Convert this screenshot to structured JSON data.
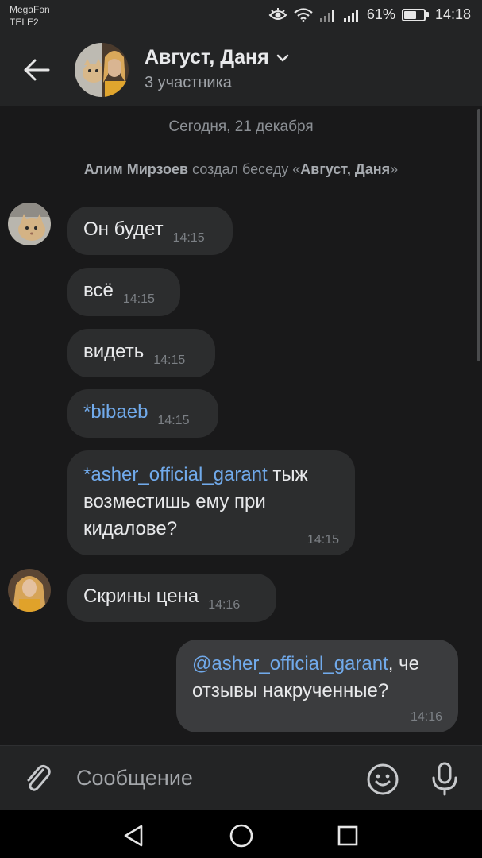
{
  "status_bar": {
    "carrier1": "MegaFon",
    "carrier2": "TELE2",
    "battery_percent": "61%",
    "battery_level": 0.61,
    "time": "14:18",
    "icons": [
      "eye-icon",
      "wifi-icon",
      "signal-icon",
      "signal-icon",
      "battery-icon"
    ]
  },
  "header": {
    "title": "Август, Даня",
    "subtitle": "3 участника"
  },
  "chat": {
    "date_separator": "Сегодня, 21 декабря",
    "service": {
      "author": "Алим Мирзоев",
      "action": "создал беседу «",
      "chat_name": "Август, Даня",
      "close": "»"
    },
    "messages": [
      {
        "text": "Он будет",
        "time": "14:15"
      },
      {
        "text": "всё",
        "time": "14:15"
      },
      {
        "text": "видеть",
        "time": "14:15"
      },
      {
        "mention": "*bibaeb",
        "time": "14:15"
      },
      {
        "mention": "*asher_official_garant",
        "text": "тыж",
        "line2": "возместишь ему при",
        "line3": "кидалове?",
        "time": "14:15"
      },
      {
        "text": "Скрины цена",
        "time": "14:16"
      },
      {
        "mention": "@asher_official_garant",
        "text": ", че",
        "line2": "отзывы накрученные?",
        "time": "14:16"
      }
    ]
  },
  "composer": {
    "placeholder": "Сообщение"
  },
  "colors": {
    "background": "#19191a",
    "panel": "#232425",
    "bubble_in": "#2c2d2e",
    "bubble_out": "#3b3c3e",
    "link": "#71aaeb",
    "muted": "#8b8f94"
  }
}
